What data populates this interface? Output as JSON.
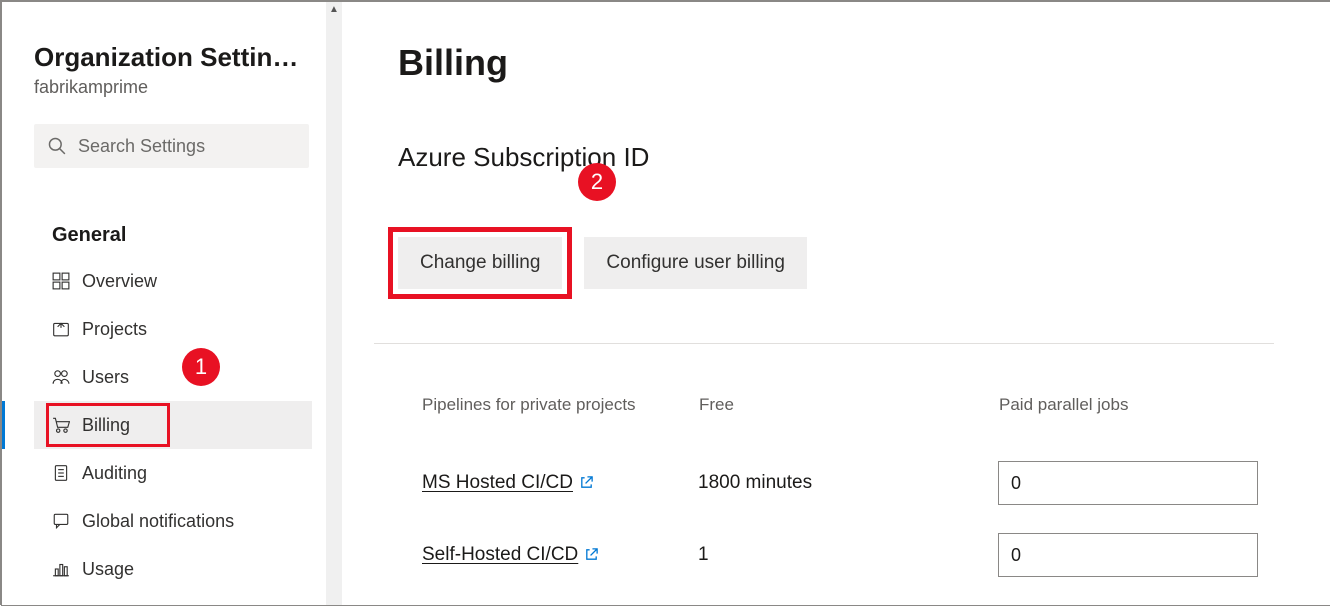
{
  "sidebar": {
    "title": "Organization Settin…",
    "org": "fabrikamprime",
    "search_placeholder": "Search Settings",
    "section": "General",
    "nav": [
      {
        "label": "Overview",
        "icon": "overview"
      },
      {
        "label": "Projects",
        "icon": "projects"
      },
      {
        "label": "Users",
        "icon": "users"
      },
      {
        "label": "Billing",
        "icon": "billing",
        "active": true
      },
      {
        "label": "Auditing",
        "icon": "auditing"
      },
      {
        "label": "Global notifications",
        "icon": "notifications"
      },
      {
        "label": "Usage",
        "icon": "usage"
      }
    ]
  },
  "main": {
    "title": "Billing",
    "subscription_heading": "Azure Subscription ID",
    "buttons": {
      "change": "Change billing",
      "configure": "Configure user billing"
    },
    "table": {
      "headers": {
        "col1": "Pipelines for private projects",
        "col2": "Free",
        "col3": "Paid parallel jobs"
      },
      "rows": [
        {
          "name": "MS Hosted CI/CD",
          "free": "1800 minutes",
          "paid": "0"
        },
        {
          "name": "Self-Hosted CI/CD",
          "free": "1",
          "paid": "0"
        }
      ]
    }
  },
  "callouts": {
    "one": "1",
    "two": "2"
  }
}
